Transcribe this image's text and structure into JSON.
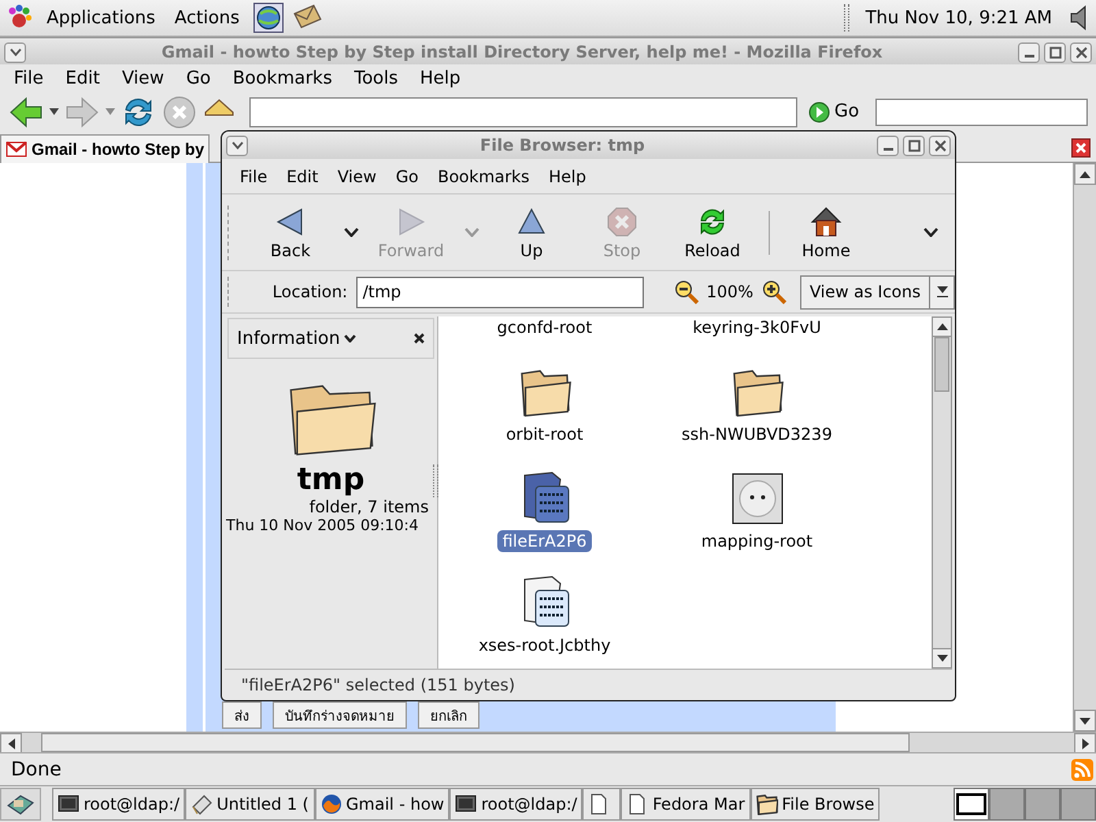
{
  "top_panel": {
    "menus": [
      "Applications",
      "Actions"
    ],
    "clock": "Thu Nov 10,  9:21 AM"
  },
  "browser": {
    "title": "Gmail - howto Step by Step install Directory Server, help me! - Mozilla Firefox",
    "menu": [
      "File",
      "Edit",
      "View",
      "Go",
      "Bookmarks",
      "Tools",
      "Help"
    ],
    "go_label": "Go",
    "tab": {
      "label": "Gmail - howto Step by"
    },
    "page_buttons": [
      "ส่ง",
      "บันทึกร่างจดหมาย",
      "ยกเลิก"
    ],
    "status": "Done"
  },
  "file_browser": {
    "title": "File Browser: tmp",
    "menu": [
      "File",
      "Edit",
      "View",
      "Go",
      "Bookmarks",
      "Help"
    ],
    "toolbar": [
      {
        "kind": "back",
        "label": "Back",
        "disabled": false
      },
      {
        "kind": "forward",
        "label": "Forward",
        "disabled": true
      },
      {
        "kind": "up",
        "label": "Up",
        "disabled": false
      },
      {
        "kind": "stop",
        "label": "Stop",
        "disabled": true
      },
      {
        "kind": "reload",
        "label": "Reload",
        "disabled": false
      },
      {
        "kind": "home",
        "label": "Home",
        "disabled": false
      }
    ],
    "location_label": "Location:",
    "location": "/tmp",
    "zoom": "100%",
    "view_mode": "View as Icons",
    "sidebar": {
      "title": "Information",
      "name": "tmp",
      "summary": "folder, 7 items",
      "date": "Thu 10 Nov 2005 09:10:4"
    },
    "files": [
      {
        "name": "gconfd-root",
        "kind": "scrolled",
        "selected": false
      },
      {
        "name": "keyring-3k0FvU",
        "kind": "scrolled",
        "selected": false
      },
      {
        "name": "orbit-root",
        "kind": "folder",
        "selected": false
      },
      {
        "name": "ssh-NWUBVD3239",
        "kind": "folder",
        "selected": false
      },
      {
        "name": "fileErA2P6",
        "kind": "text",
        "selected": true
      },
      {
        "name": "mapping-root",
        "kind": "socket",
        "selected": false
      },
      {
        "name": "xses-root.Jcbthy",
        "kind": "text",
        "selected": false
      }
    ],
    "status": "\"fileErA2P6\" selected (151 bytes)"
  },
  "taskbar": {
    "items": [
      {
        "kind": "terminal",
        "label": "root@ldap:/"
      },
      {
        "kind": "editor",
        "label": "Untitled 1 ("
      },
      {
        "kind": "browser",
        "label": "Gmail - how"
      },
      {
        "kind": "terminal",
        "label": "root@ldap:/"
      },
      {
        "kind": "document"
      },
      {
        "kind": "document",
        "label": "Fedora Mar"
      },
      {
        "kind": "folder",
        "label": "File Browse"
      }
    ],
    "workspaces": [
      {
        "selected": true
      },
      {
        "selected": false
      },
      {
        "selected": false
      },
      {
        "selected": false
      }
    ]
  }
}
